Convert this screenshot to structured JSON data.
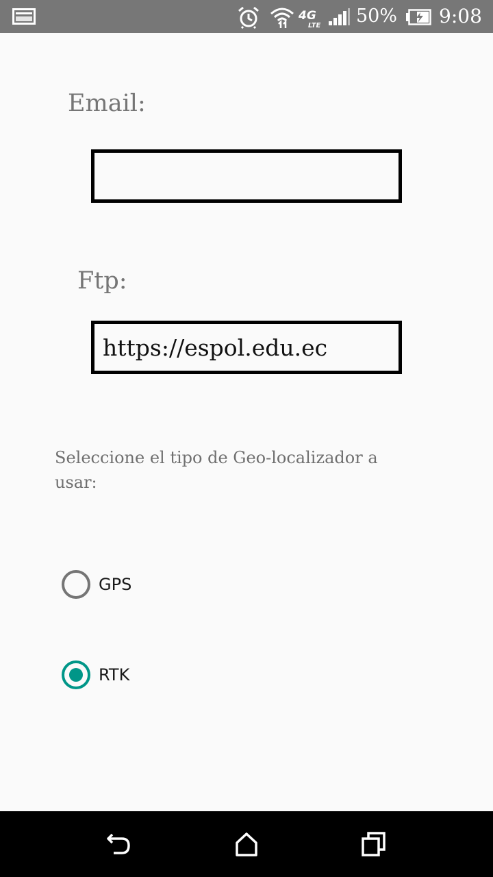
{
  "status_bar": {
    "battery_percent": "50%",
    "time": "9:08",
    "icons": [
      "notification-icon",
      "alarm-icon",
      "wifi-icon",
      "4g-lte-icon",
      "signal-icon",
      "battery-charging-icon"
    ],
    "network_label": "4G",
    "network_sub_label": "LTE"
  },
  "form": {
    "email_label": "Email:",
    "email_value": "",
    "ftp_label": "Ftp:",
    "ftp_value": "https://espol.edu.ec",
    "prompt": "Seleccione el tipo de Geo-localizador a usar:",
    "options": [
      {
        "label": "GPS",
        "checked": false
      },
      {
        "label": "RTK",
        "checked": true
      }
    ]
  },
  "colors": {
    "status_bar": "#777777",
    "accent": "#009688",
    "background": "#fafafa",
    "nav_bar": "#000000"
  },
  "nav_bar": {
    "icons": [
      "back-icon",
      "home-icon",
      "recents-icon"
    ]
  }
}
